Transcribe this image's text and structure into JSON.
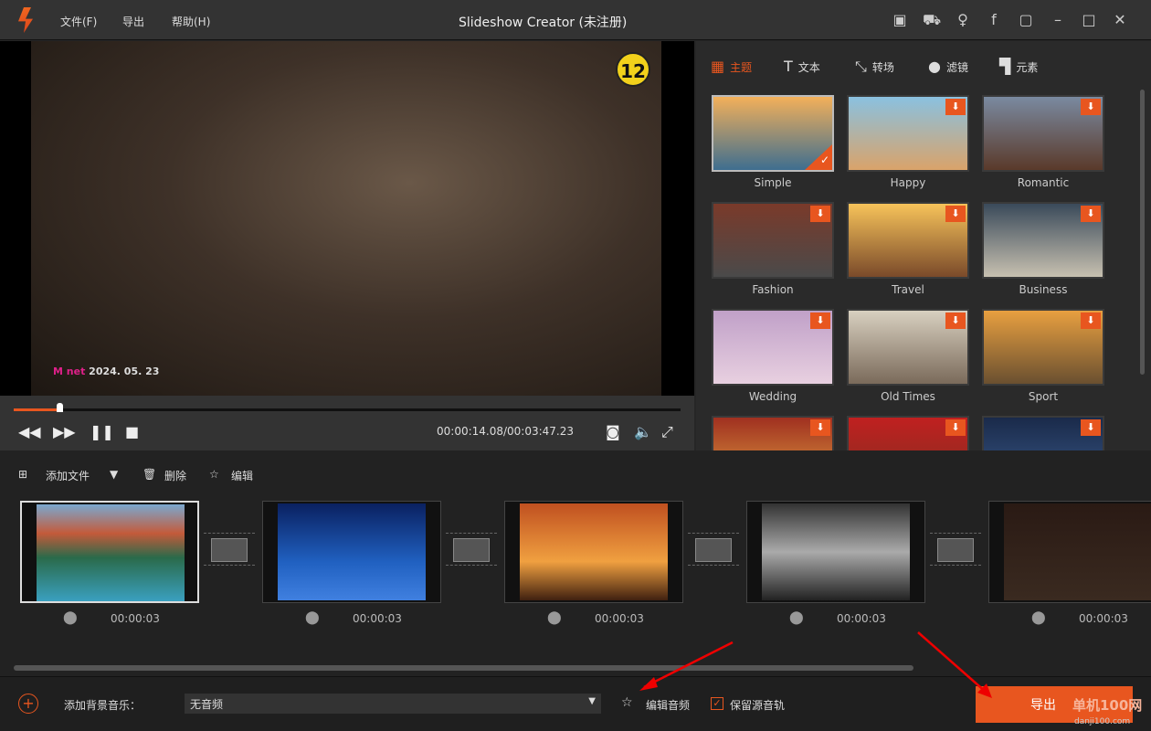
{
  "app": {
    "title": "Slideshow Creator (未注册)",
    "menu": [
      "文件(F)",
      "导出",
      "帮助(H)"
    ],
    "title_icons": [
      "save-icon",
      "cart-icon",
      "key-icon",
      "facebook-icon",
      "feedback-icon",
      "minimize-icon",
      "maximize-icon",
      "close-icon"
    ]
  },
  "preview": {
    "badge": "12",
    "watermark_brand": "M net",
    "watermark_date": "2024. 05. 23",
    "time": "00:00:14.08/00:03:47.23",
    "progress_fraction": 0.068
  },
  "panel": {
    "tabs": [
      "主题",
      "文本",
      "转场",
      "滤镜",
      "元素"
    ],
    "active_tab": "主题",
    "themes": [
      {
        "label": "Simple",
        "selected": true
      },
      {
        "label": "Happy"
      },
      {
        "label": "Romantic"
      },
      {
        "label": "Fashion"
      },
      {
        "label": "Travel"
      },
      {
        "label": "Business"
      },
      {
        "label": "Wedding"
      },
      {
        "label": "Old Times"
      },
      {
        "label": "Sport"
      },
      {
        "label": ""
      },
      {
        "label": ""
      },
      {
        "label": ""
      }
    ]
  },
  "toolbar": {
    "add_file": "添加文件",
    "delete": "删除",
    "edit": "编辑"
  },
  "timeline": {
    "clips": [
      {
        "duration": "00:00:03"
      },
      {
        "duration": "00:00:03"
      },
      {
        "duration": "00:00:03"
      },
      {
        "duration": "00:00:03"
      },
      {
        "duration": "00:00:03"
      }
    ]
  },
  "bottom": {
    "add_music_label": "添加背景音乐：",
    "music_value": "无音频",
    "edit_audio": "编辑音频",
    "keep_audio": "保留源音轨",
    "keep_audio_checked": true,
    "export": "导出",
    "site_watermark": "单机100网",
    "site_url": "danji100.com"
  },
  "colors": {
    "accent": "#e8561f"
  }
}
